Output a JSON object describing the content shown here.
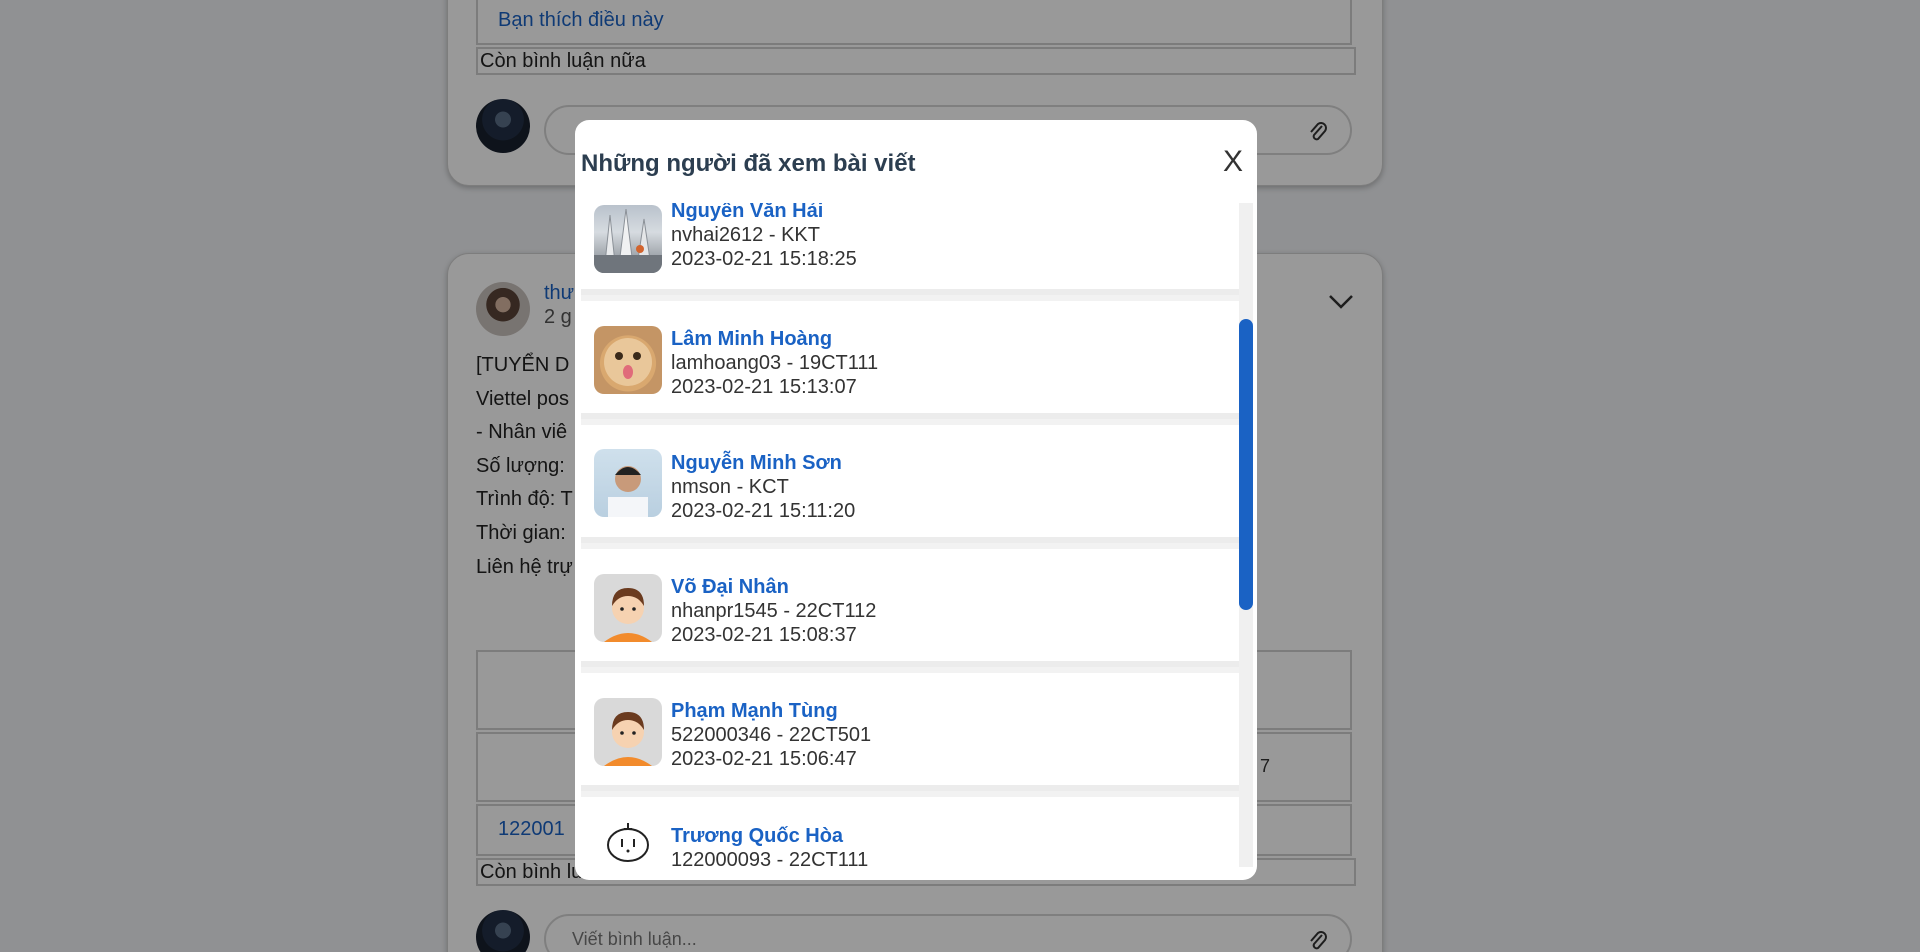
{
  "background": {
    "card1": {
      "you_like_this": "Bạn thích điều này",
      "more_comments": "Còn bình luận nữa"
    },
    "card2": {
      "author_partial": "thư",
      "time_partial": "2 g",
      "post_lines": [
        "[TUYỂN D",
        "Viettel pos",
        "- Nhân viê",
        "Số lượng:",
        "Trình độ: T",
        "Thời gian:",
        "Liên hệ trự"
      ],
      "table_value_right": "7",
      "row_link_partial": "122001",
      "more_comments_partial": "Còn bình lu",
      "comment_placeholder": "Viết bình luận..."
    }
  },
  "modal": {
    "title": "Những người đã xem bài viết",
    "close_label": "X",
    "viewers": [
      {
        "name": "Nguyên Văn Hải",
        "meta": "nvhai2612 - KKT",
        "time": "2023-02-21 15:18:25",
        "avatar_icon": "building-photo-avatar"
      },
      {
        "name": "Lâm Minh Hoàng",
        "meta": "lamhoang03 - 19CT111",
        "time": "2023-02-21 15:13:07",
        "avatar_icon": "cat-photo-avatar"
      },
      {
        "name": "Nguyễn Minh Sơn",
        "meta": "nmson - KCT",
        "time": "2023-02-21 15:11:20",
        "avatar_icon": "man-photo-avatar"
      },
      {
        "name": "Võ Đại Nhân",
        "meta": "nhanpr1545 - 22CT112",
        "time": "2023-02-21 15:08:37",
        "avatar_icon": "cartoon-boy-avatar"
      },
      {
        "name": "Phạm Mạnh Tùng",
        "meta": "522000346 - 22CT501",
        "time": "2023-02-21 15:06:47",
        "avatar_icon": "cartoon-boy-avatar"
      },
      {
        "name": "Trương Quốc Hòa",
        "meta": "122000093 - 22CT111",
        "time": "",
        "avatar_icon": "sketch-face-avatar"
      }
    ]
  },
  "colors": {
    "accent": "#1a62c4",
    "overlay": "rgba(0,0,0,0.4)"
  }
}
